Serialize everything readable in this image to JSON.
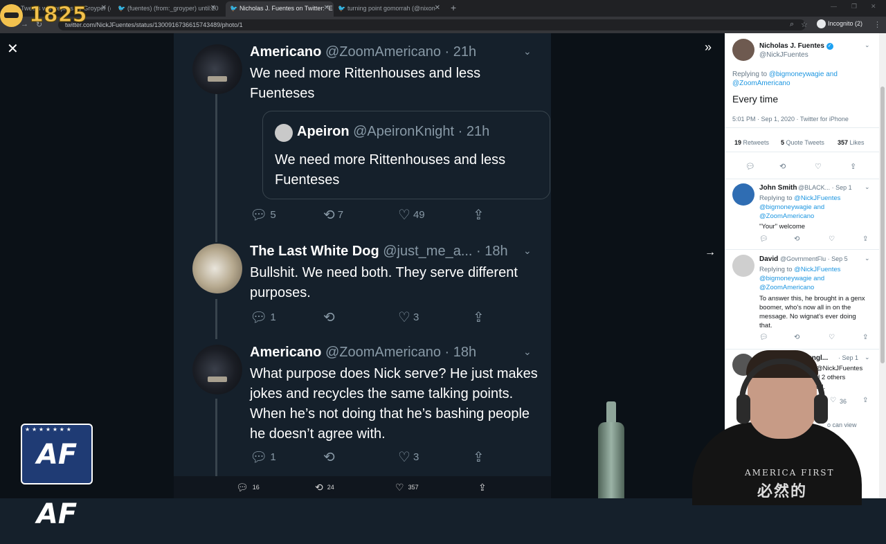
{
  "stream": {
    "counter": "1825"
  },
  "browser": {
    "tabs": [
      {
        "label": "Tweets with replies by Groyper (@"
      },
      {
        "label": "(fuentes) (from:_groyper) until:20"
      },
      {
        "label": "Nicholas J. Fuentes on Twitter: \"E"
      },
      {
        "label": "turning point gomorrah (@nixon"
      }
    ],
    "url": "twitter.com/NickJFuentes/status/1300916736615743489/photo/1",
    "incognito": "Incognito (2)"
  },
  "photo": {
    "tweets": [
      {
        "name": "Americano",
        "handle": "@ZoomAmericano · 21h",
        "text": "We need more Rittenhouses and less Fuenteses",
        "quote": {
          "name": "Apeiron",
          "handle": "@ApeironKnight · 21h",
          "text": "We need more Rittenhouses and less Fuenteses"
        },
        "replies": "5",
        "retweets": "7",
        "likes": "49"
      },
      {
        "name": "The Last White Dog",
        "handle": "@just_me_a... · 18h",
        "text": "Bullshit. We need both. They serve different purposes.",
        "replies": "1",
        "retweets": "",
        "likes": "3"
      },
      {
        "name": "Americano",
        "handle": "@ZoomAmericano · 18h",
        "text": "What purpose does Nick serve? He just makes jokes and recycles the same talking points. When he’s not doing that he’s bashing people he doesn’t agree with.",
        "replies": "1",
        "retweets": "",
        "likes": "3"
      }
    ]
  },
  "bottombar": {
    "replies": "16",
    "retweets": "24",
    "likes": "357"
  },
  "logo": {
    "text": "AF AF"
  },
  "panel": {
    "main": {
      "name": "Nicholas J. Fuentes",
      "handle": "@NickJFuentes",
      "replying_label": "Replying to",
      "replying_to": "@bigmoneywagie and @ZoomAmericano",
      "text": "Every time",
      "meta": "5:01 PM · Sep 1, 2020 · Twitter for iPhone",
      "retweets_num": "19",
      "retweets_label": "Retweets",
      "quotes_num": "5",
      "quotes_label": "Quote Tweets",
      "likes_num": "357",
      "likes_label": "Likes"
    },
    "replies": [
      {
        "name": "John Smith",
        "handle": "@BLACK... · Sep 1",
        "replying_label": "Replying to",
        "replying_to": "@NickJFuentes @bigmoneywagie and @ZoomAmericano",
        "text": "\"Your\" welcome"
      },
      {
        "name": "David",
        "handle": "@GovrnmentFlu · Sep 5",
        "replying_label": "Replying to",
        "replying_to": "@NickJFuentes @bigmoneywagie and @ZoomAmericano",
        "text": "To answer this, he brought in a genx boomer, who's now all in on the message.  No wignat's ever doing that."
      },
      {
        "name": "Sungl...",
        "handle": "· Sep 1",
        "replying_partial": "@NickJFuentes",
        "others": "d 2 others",
        "text_partial": "ed.",
        "likes": "36",
        "can_view": "o can view"
      }
    ]
  },
  "cam": {
    "shirt": "AMERICA FIRST",
    "shirt_cn": "必然的"
  }
}
